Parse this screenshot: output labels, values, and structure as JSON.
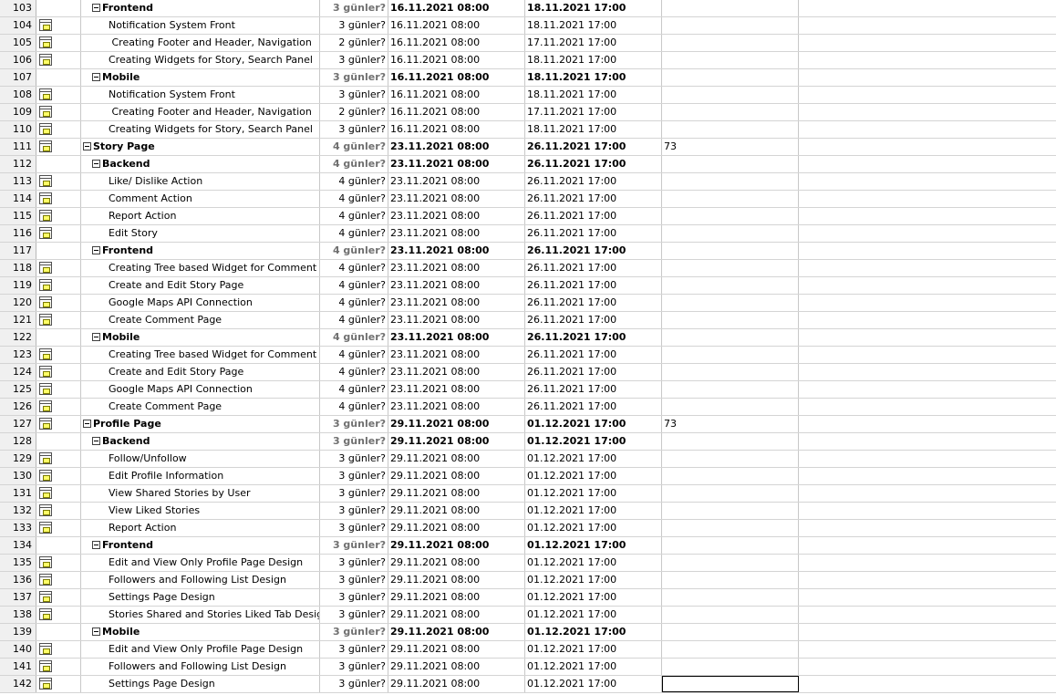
{
  "rows": [
    {
      "id": "103",
      "level": 1,
      "summary": true,
      "cal": false,
      "name": "Frontend",
      "duration": "3 günler?",
      "start": "16.11.2021 08:00",
      "finish": "18.11.2021 17:00",
      "pred": ""
    },
    {
      "id": "104",
      "level": 2,
      "summary": false,
      "cal": true,
      "name": "Notification System Front",
      "duration": "3 günler?",
      "start": "16.11.2021 08:00",
      "finish": "18.11.2021 17:00",
      "pred": ""
    },
    {
      "id": "105",
      "level": 2,
      "summary": false,
      "cal": true,
      "name": " Creating Footer and Header, Navigation",
      "duration": "2 günler?",
      "start": "16.11.2021 08:00",
      "finish": "17.11.2021 17:00",
      "pred": ""
    },
    {
      "id": "106",
      "level": 2,
      "summary": false,
      "cal": true,
      "name": "Creating Widgets for Story, Search Panel",
      "duration": "3 günler?",
      "start": "16.11.2021 08:00",
      "finish": "18.11.2021 17:00",
      "pred": ""
    },
    {
      "id": "107",
      "level": 1,
      "summary": true,
      "cal": false,
      "name": "Mobile",
      "duration": "3 günler?",
      "start": "16.11.2021 08:00",
      "finish": "18.11.2021 17:00",
      "pred": ""
    },
    {
      "id": "108",
      "level": 2,
      "summary": false,
      "cal": true,
      "name": "Notification System Front",
      "duration": "3 günler?",
      "start": "16.11.2021 08:00",
      "finish": "18.11.2021 17:00",
      "pred": ""
    },
    {
      "id": "109",
      "level": 2,
      "summary": false,
      "cal": true,
      "name": " Creating Footer and Header, Navigation",
      "duration": "2 günler?",
      "start": "16.11.2021 08:00",
      "finish": "17.11.2021 17:00",
      "pred": ""
    },
    {
      "id": "110",
      "level": 2,
      "summary": false,
      "cal": true,
      "name": "Creating Widgets for Story, Search Panel",
      "duration": "3 günler?",
      "start": "16.11.2021 08:00",
      "finish": "18.11.2021 17:00",
      "pred": ""
    },
    {
      "id": "111",
      "level": 0,
      "summary": true,
      "cal": true,
      "name": "Story Page",
      "duration": "4 günler?",
      "start": "23.11.2021 08:00",
      "finish": "26.11.2021 17:00",
      "pred": "73"
    },
    {
      "id": "112",
      "level": 1,
      "summary": true,
      "cal": false,
      "name": "Backend",
      "duration": "4 günler?",
      "start": "23.11.2021 08:00",
      "finish": "26.11.2021 17:00",
      "pred": ""
    },
    {
      "id": "113",
      "level": 2,
      "summary": false,
      "cal": true,
      "name": "Like/ Dislike Action",
      "duration": "4 günler?",
      "start": "23.11.2021 08:00",
      "finish": "26.11.2021 17:00",
      "pred": ""
    },
    {
      "id": "114",
      "level": 2,
      "summary": false,
      "cal": true,
      "name": "Comment Action",
      "duration": "4 günler?",
      "start": "23.11.2021 08:00",
      "finish": "26.11.2021 17:00",
      "pred": ""
    },
    {
      "id": "115",
      "level": 2,
      "summary": false,
      "cal": true,
      "name": "Report Action",
      "duration": "4 günler?",
      "start": "23.11.2021 08:00",
      "finish": "26.11.2021 17:00",
      "pred": ""
    },
    {
      "id": "116",
      "level": 2,
      "summary": false,
      "cal": true,
      "name": "Edit Story",
      "duration": "4 günler?",
      "start": "23.11.2021 08:00",
      "finish": "26.11.2021 17:00",
      "pred": ""
    },
    {
      "id": "117",
      "level": 1,
      "summary": true,
      "cal": false,
      "name": "Frontend",
      "duration": "4 günler?",
      "start": "23.11.2021 08:00",
      "finish": "26.11.2021 17:00",
      "pred": ""
    },
    {
      "id": "118",
      "level": 2,
      "summary": false,
      "cal": true,
      "name": "Creating Tree based Widget for Comment",
      "duration": "4 günler?",
      "start": "23.11.2021 08:00",
      "finish": "26.11.2021 17:00",
      "pred": ""
    },
    {
      "id": "119",
      "level": 2,
      "summary": false,
      "cal": true,
      "name": "Create and Edit Story Page",
      "duration": "4 günler?",
      "start": "23.11.2021 08:00",
      "finish": "26.11.2021 17:00",
      "pred": ""
    },
    {
      "id": "120",
      "level": 2,
      "summary": false,
      "cal": true,
      "name": "Google Maps API Connection",
      "duration": "4 günler?",
      "start": "23.11.2021 08:00",
      "finish": "26.11.2021 17:00",
      "pred": ""
    },
    {
      "id": "121",
      "level": 2,
      "summary": false,
      "cal": true,
      "name": "Create Comment Page",
      "duration": "4 günler?",
      "start": "23.11.2021 08:00",
      "finish": "26.11.2021 17:00",
      "pred": ""
    },
    {
      "id": "122",
      "level": 1,
      "summary": true,
      "cal": false,
      "name": "Mobile",
      "duration": "4 günler?",
      "start": "23.11.2021 08:00",
      "finish": "26.11.2021 17:00",
      "pred": ""
    },
    {
      "id": "123",
      "level": 2,
      "summary": false,
      "cal": true,
      "name": "Creating Tree based Widget for Comment",
      "duration": "4 günler?",
      "start": "23.11.2021 08:00",
      "finish": "26.11.2021 17:00",
      "pred": ""
    },
    {
      "id": "124",
      "level": 2,
      "summary": false,
      "cal": true,
      "name": "Create and Edit Story Page",
      "duration": "4 günler?",
      "start": "23.11.2021 08:00",
      "finish": "26.11.2021 17:00",
      "pred": ""
    },
    {
      "id": "125",
      "level": 2,
      "summary": false,
      "cal": true,
      "name": "Google Maps API Connection",
      "duration": "4 günler?",
      "start": "23.11.2021 08:00",
      "finish": "26.11.2021 17:00",
      "pred": ""
    },
    {
      "id": "126",
      "level": 2,
      "summary": false,
      "cal": true,
      "name": "Create Comment Page",
      "duration": "4 günler?",
      "start": "23.11.2021 08:00",
      "finish": "26.11.2021 17:00",
      "pred": ""
    },
    {
      "id": "127",
      "level": 0,
      "summary": true,
      "cal": true,
      "name": "Profile Page",
      "duration": "3 günler?",
      "start": "29.11.2021 08:00",
      "finish": "01.12.2021 17:00",
      "pred": "73"
    },
    {
      "id": "128",
      "level": 1,
      "summary": true,
      "cal": false,
      "name": "Backend",
      "duration": "3 günler?",
      "start": "29.11.2021 08:00",
      "finish": "01.12.2021 17:00",
      "pred": ""
    },
    {
      "id": "129",
      "level": 2,
      "summary": false,
      "cal": true,
      "name": "Follow/Unfollow",
      "duration": "3 günler?",
      "start": "29.11.2021 08:00",
      "finish": "01.12.2021 17:00",
      "pred": ""
    },
    {
      "id": "130",
      "level": 2,
      "summary": false,
      "cal": true,
      "name": "Edit Profile Information",
      "duration": "3 günler?",
      "start": "29.11.2021 08:00",
      "finish": "01.12.2021 17:00",
      "pred": ""
    },
    {
      "id": "131",
      "level": 2,
      "summary": false,
      "cal": true,
      "name": "View Shared Stories by User",
      "duration": "3 günler?",
      "start": "29.11.2021 08:00",
      "finish": "01.12.2021 17:00",
      "pred": ""
    },
    {
      "id": "132",
      "level": 2,
      "summary": false,
      "cal": true,
      "name": "View Liked Stories",
      "duration": "3 günler?",
      "start": "29.11.2021 08:00",
      "finish": "01.12.2021 17:00",
      "pred": ""
    },
    {
      "id": "133",
      "level": 2,
      "summary": false,
      "cal": true,
      "name": "Report Action",
      "duration": "3 günler?",
      "start": "29.11.2021 08:00",
      "finish": "01.12.2021 17:00",
      "pred": ""
    },
    {
      "id": "134",
      "level": 1,
      "summary": true,
      "cal": false,
      "name": "Frontend",
      "duration": "3 günler?",
      "start": "29.11.2021 08:00",
      "finish": "01.12.2021 17:00",
      "pred": ""
    },
    {
      "id": "135",
      "level": 2,
      "summary": false,
      "cal": true,
      "name": "Edit and View Only Profile Page Design",
      "duration": "3 günler?",
      "start": "29.11.2021 08:00",
      "finish": "01.12.2021 17:00",
      "pred": ""
    },
    {
      "id": "136",
      "level": 2,
      "summary": false,
      "cal": true,
      "name": "Followers and Following List Design",
      "duration": "3 günler?",
      "start": "29.11.2021 08:00",
      "finish": "01.12.2021 17:00",
      "pred": ""
    },
    {
      "id": "137",
      "level": 2,
      "summary": false,
      "cal": true,
      "name": "Settings Page Design",
      "duration": "3 günler?",
      "start": "29.11.2021 08:00",
      "finish": "01.12.2021 17:00",
      "pred": ""
    },
    {
      "id": "138",
      "level": 2,
      "summary": false,
      "cal": true,
      "name": "Stories Shared and Stories Liked Tab Design",
      "duration": "3 günler?",
      "start": "29.11.2021 08:00",
      "finish": "01.12.2021 17:00",
      "pred": ""
    },
    {
      "id": "139",
      "level": 1,
      "summary": true,
      "cal": false,
      "name": "Mobile",
      "duration": "3 günler?",
      "start": "29.11.2021 08:00",
      "finish": "01.12.2021 17:00",
      "pred": ""
    },
    {
      "id": "140",
      "level": 2,
      "summary": false,
      "cal": true,
      "name": "Edit and View Only Profile Page Design",
      "duration": "3 günler?",
      "start": "29.11.2021 08:00",
      "finish": "01.12.2021 17:00",
      "pred": ""
    },
    {
      "id": "141",
      "level": 2,
      "summary": false,
      "cal": true,
      "name": "Followers and Following List Design",
      "duration": "3 günler?",
      "start": "29.11.2021 08:00",
      "finish": "01.12.2021 17:00",
      "pred": ""
    },
    {
      "id": "142",
      "level": 2,
      "summary": false,
      "cal": true,
      "name": "Settings Page Design",
      "duration": "3 günler?",
      "start": "29.11.2021 08:00",
      "finish": "01.12.2021 17:00",
      "pred": "",
      "selected_pred": true
    }
  ]
}
